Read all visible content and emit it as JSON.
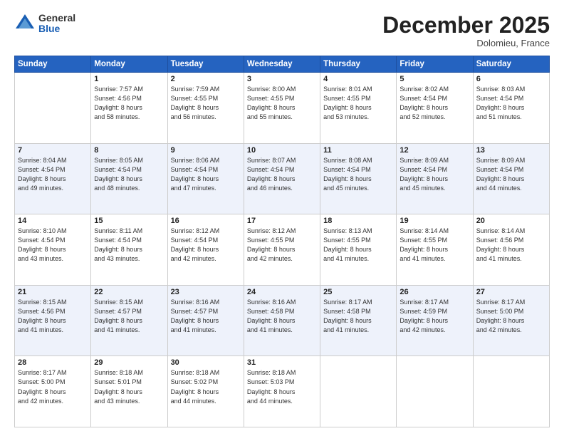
{
  "header": {
    "logo_general": "General",
    "logo_blue": "Blue",
    "month_title": "December 2025",
    "subtitle": "Dolomieu, France"
  },
  "weekdays": [
    "Sunday",
    "Monday",
    "Tuesday",
    "Wednesday",
    "Thursday",
    "Friday",
    "Saturday"
  ],
  "weeks": [
    [
      {
        "day": "",
        "info": ""
      },
      {
        "day": "1",
        "info": "Sunrise: 7:57 AM\nSunset: 4:56 PM\nDaylight: 8 hours\nand 58 minutes."
      },
      {
        "day": "2",
        "info": "Sunrise: 7:59 AM\nSunset: 4:55 PM\nDaylight: 8 hours\nand 56 minutes."
      },
      {
        "day": "3",
        "info": "Sunrise: 8:00 AM\nSunset: 4:55 PM\nDaylight: 8 hours\nand 55 minutes."
      },
      {
        "day": "4",
        "info": "Sunrise: 8:01 AM\nSunset: 4:55 PM\nDaylight: 8 hours\nand 53 minutes."
      },
      {
        "day": "5",
        "info": "Sunrise: 8:02 AM\nSunset: 4:54 PM\nDaylight: 8 hours\nand 52 minutes."
      },
      {
        "day": "6",
        "info": "Sunrise: 8:03 AM\nSunset: 4:54 PM\nDaylight: 8 hours\nand 51 minutes."
      }
    ],
    [
      {
        "day": "7",
        "info": "Sunrise: 8:04 AM\nSunset: 4:54 PM\nDaylight: 8 hours\nand 49 minutes."
      },
      {
        "day": "8",
        "info": "Sunrise: 8:05 AM\nSunset: 4:54 PM\nDaylight: 8 hours\nand 48 minutes."
      },
      {
        "day": "9",
        "info": "Sunrise: 8:06 AM\nSunset: 4:54 PM\nDaylight: 8 hours\nand 47 minutes."
      },
      {
        "day": "10",
        "info": "Sunrise: 8:07 AM\nSunset: 4:54 PM\nDaylight: 8 hours\nand 46 minutes."
      },
      {
        "day": "11",
        "info": "Sunrise: 8:08 AM\nSunset: 4:54 PM\nDaylight: 8 hours\nand 45 minutes."
      },
      {
        "day": "12",
        "info": "Sunrise: 8:09 AM\nSunset: 4:54 PM\nDaylight: 8 hours\nand 45 minutes."
      },
      {
        "day": "13",
        "info": "Sunrise: 8:09 AM\nSunset: 4:54 PM\nDaylight: 8 hours\nand 44 minutes."
      }
    ],
    [
      {
        "day": "14",
        "info": "Sunrise: 8:10 AM\nSunset: 4:54 PM\nDaylight: 8 hours\nand 43 minutes."
      },
      {
        "day": "15",
        "info": "Sunrise: 8:11 AM\nSunset: 4:54 PM\nDaylight: 8 hours\nand 43 minutes."
      },
      {
        "day": "16",
        "info": "Sunrise: 8:12 AM\nSunset: 4:54 PM\nDaylight: 8 hours\nand 42 minutes."
      },
      {
        "day": "17",
        "info": "Sunrise: 8:12 AM\nSunset: 4:55 PM\nDaylight: 8 hours\nand 42 minutes."
      },
      {
        "day": "18",
        "info": "Sunrise: 8:13 AM\nSunset: 4:55 PM\nDaylight: 8 hours\nand 41 minutes."
      },
      {
        "day": "19",
        "info": "Sunrise: 8:14 AM\nSunset: 4:55 PM\nDaylight: 8 hours\nand 41 minutes."
      },
      {
        "day": "20",
        "info": "Sunrise: 8:14 AM\nSunset: 4:56 PM\nDaylight: 8 hours\nand 41 minutes."
      }
    ],
    [
      {
        "day": "21",
        "info": "Sunrise: 8:15 AM\nSunset: 4:56 PM\nDaylight: 8 hours\nand 41 minutes."
      },
      {
        "day": "22",
        "info": "Sunrise: 8:15 AM\nSunset: 4:57 PM\nDaylight: 8 hours\nand 41 minutes."
      },
      {
        "day": "23",
        "info": "Sunrise: 8:16 AM\nSunset: 4:57 PM\nDaylight: 8 hours\nand 41 minutes."
      },
      {
        "day": "24",
        "info": "Sunrise: 8:16 AM\nSunset: 4:58 PM\nDaylight: 8 hours\nand 41 minutes."
      },
      {
        "day": "25",
        "info": "Sunrise: 8:17 AM\nSunset: 4:58 PM\nDaylight: 8 hours\nand 41 minutes."
      },
      {
        "day": "26",
        "info": "Sunrise: 8:17 AM\nSunset: 4:59 PM\nDaylight: 8 hours\nand 42 minutes."
      },
      {
        "day": "27",
        "info": "Sunrise: 8:17 AM\nSunset: 5:00 PM\nDaylight: 8 hours\nand 42 minutes."
      }
    ],
    [
      {
        "day": "28",
        "info": "Sunrise: 8:17 AM\nSunset: 5:00 PM\nDaylight: 8 hours\nand 42 minutes."
      },
      {
        "day": "29",
        "info": "Sunrise: 8:18 AM\nSunset: 5:01 PM\nDaylight: 8 hours\nand 43 minutes."
      },
      {
        "day": "30",
        "info": "Sunrise: 8:18 AM\nSunset: 5:02 PM\nDaylight: 8 hours\nand 44 minutes."
      },
      {
        "day": "31",
        "info": "Sunrise: 8:18 AM\nSunset: 5:03 PM\nDaylight: 8 hours\nand 44 minutes."
      },
      {
        "day": "",
        "info": ""
      },
      {
        "day": "",
        "info": ""
      },
      {
        "day": "",
        "info": ""
      }
    ]
  ]
}
